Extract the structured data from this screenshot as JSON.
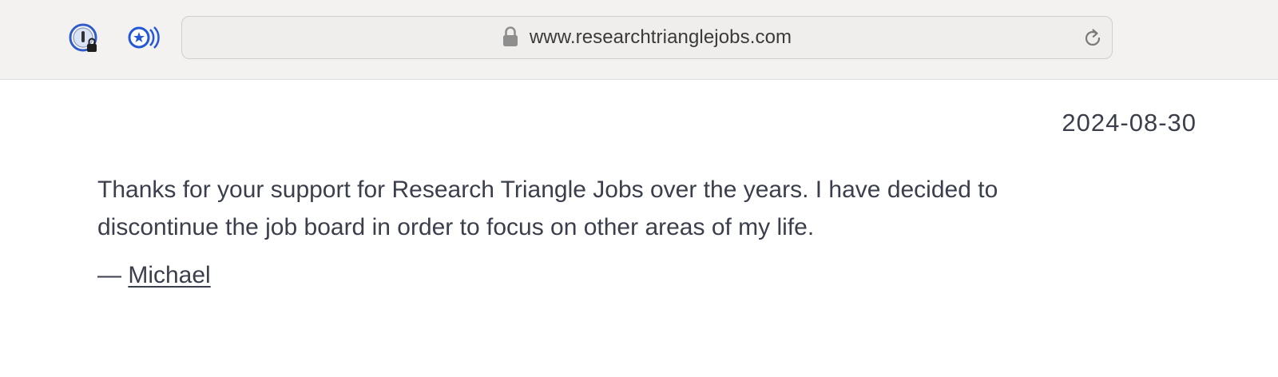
{
  "browser": {
    "url": "www.researchtrianglejobs.com",
    "extensions": [
      {
        "icon": "password-manager-icon"
      },
      {
        "icon": "reading-list-audio-icon"
      }
    ],
    "lock_icon": "lock-icon",
    "reload_icon": "reload-icon"
  },
  "page": {
    "date": "2024-08-30",
    "message": "Thanks for your support for Research Triangle Jobs over the years. I have decided to discontinue the job board in order to focus on other areas of my life.",
    "signature_dash": "— ",
    "signature_name": "Michael"
  },
  "colors": {
    "toolbar_bg": "#f3f2f1",
    "text": "#3a3f4b",
    "accent_blue": "#2457d6"
  }
}
